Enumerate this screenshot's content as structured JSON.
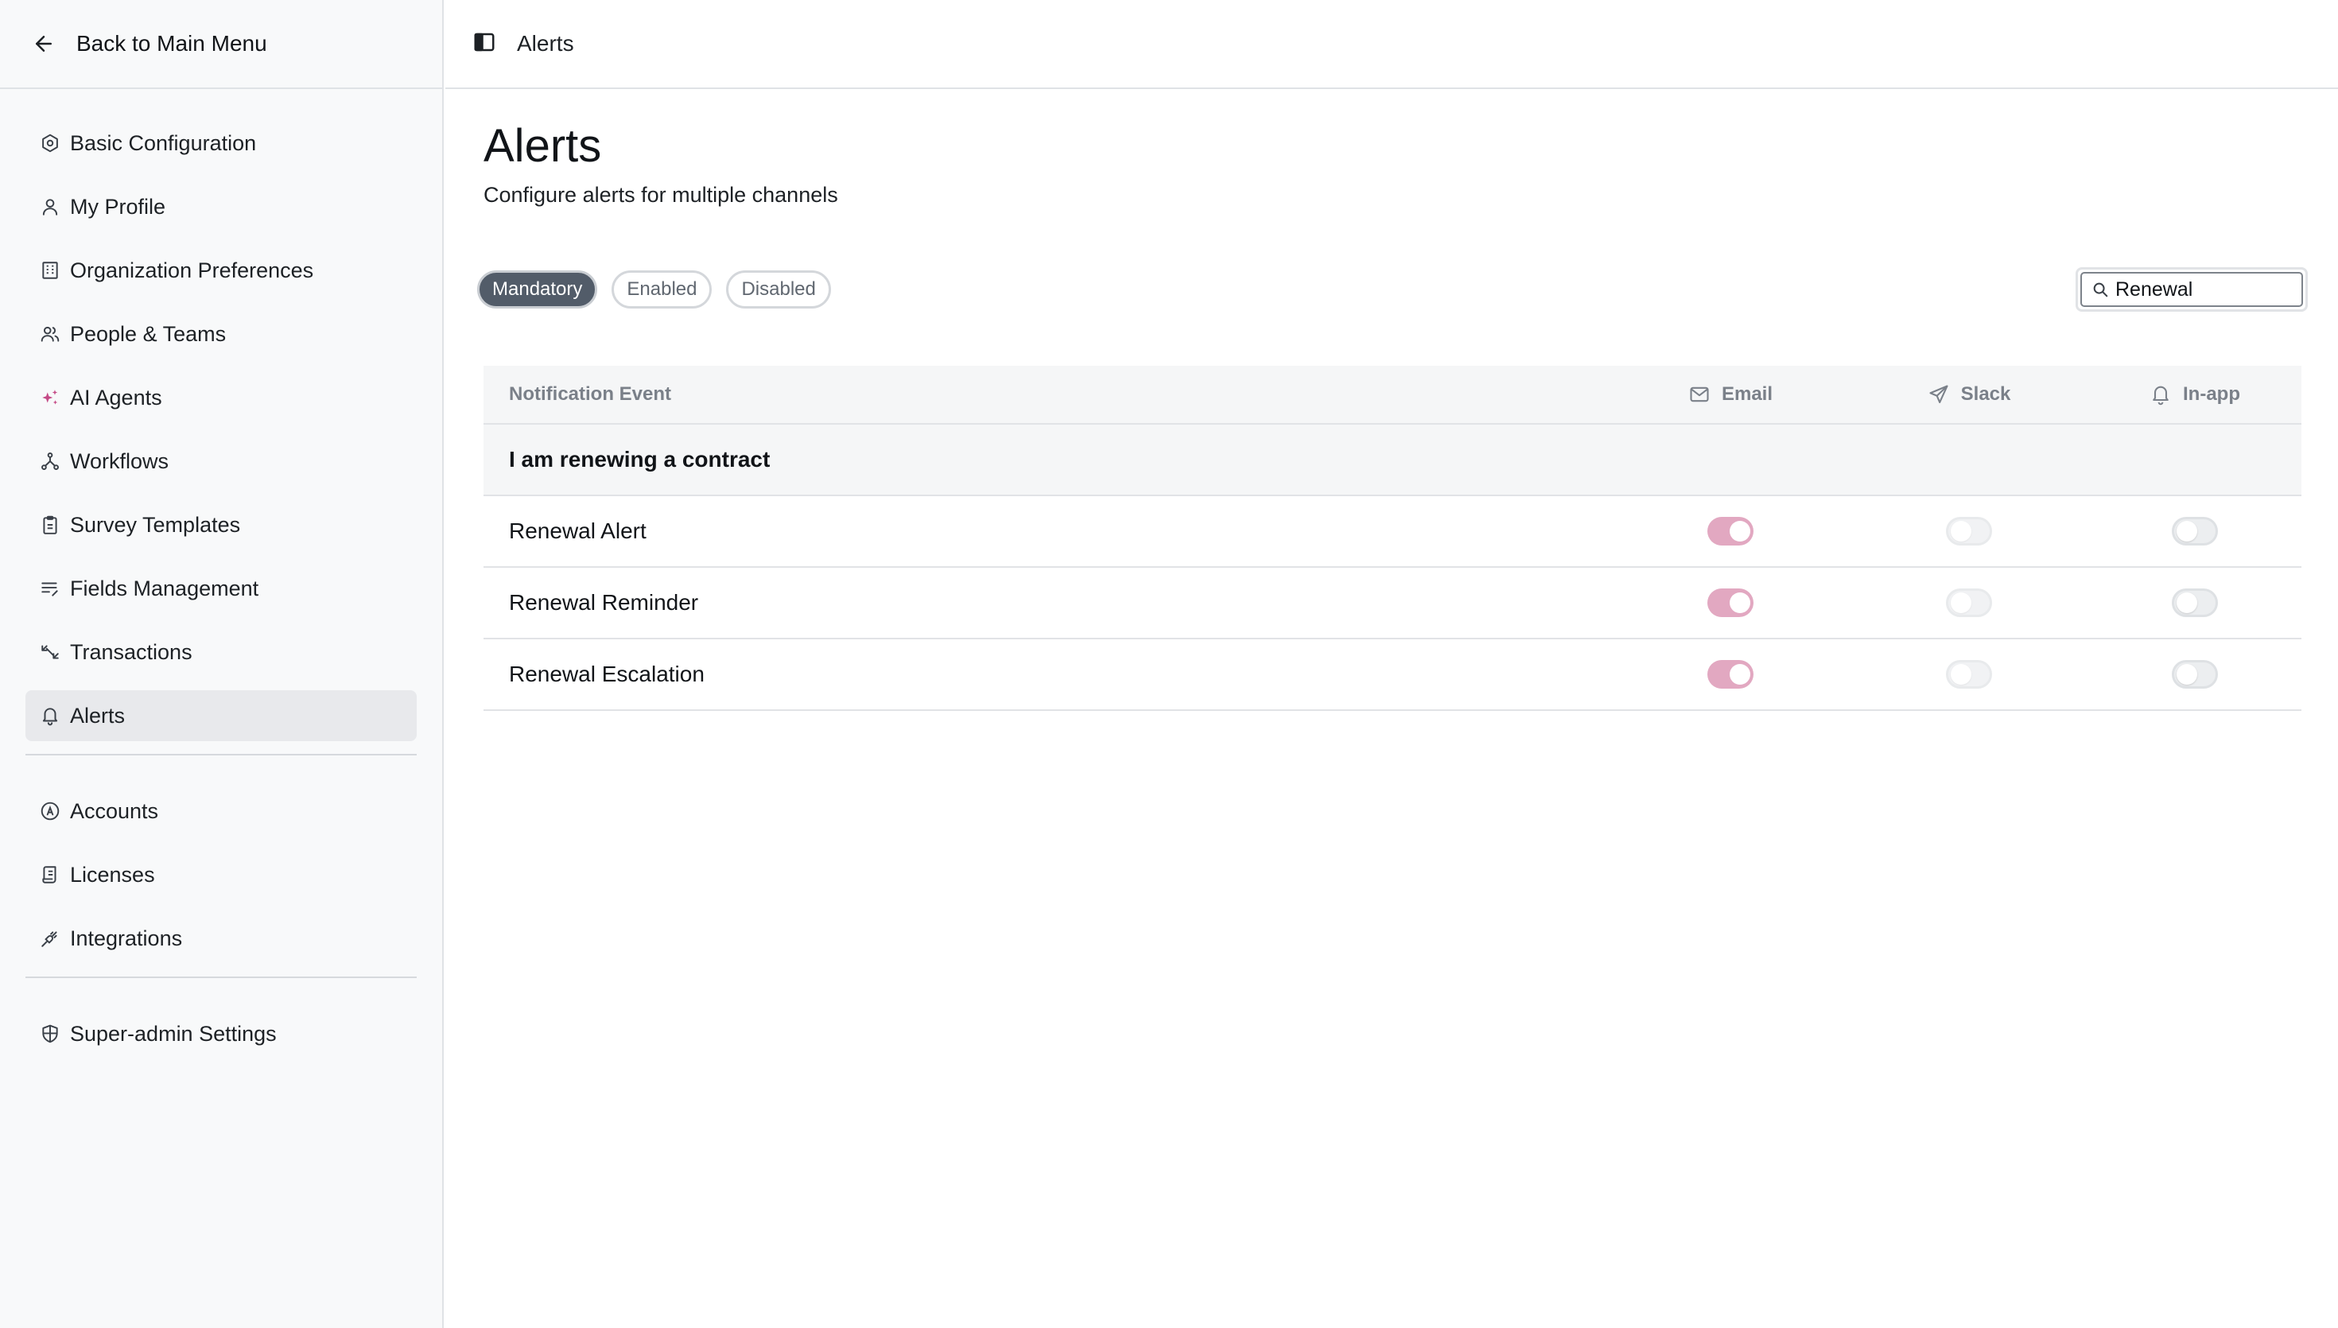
{
  "sidebar": {
    "back_label": "Back to Main Menu",
    "groups": [
      {
        "items": [
          {
            "label": "Basic Configuration",
            "icon": "hexagon-settings-icon"
          },
          {
            "label": "My Profile",
            "icon": "user-icon"
          },
          {
            "label": "Organization Preferences",
            "icon": "building-icon"
          },
          {
            "label": "People & Teams",
            "icon": "users-icon"
          },
          {
            "label": "AI Agents",
            "icon": "sparkles-icon"
          },
          {
            "label": "Workflows",
            "icon": "workflow-icon"
          },
          {
            "label": "Survey Templates",
            "icon": "clipboard-icon"
          },
          {
            "label": "Fields Management",
            "icon": "list-edit-icon"
          },
          {
            "label": "Transactions",
            "icon": "arrows-icon"
          },
          {
            "label": "Alerts",
            "icon": "bell-icon",
            "active": true
          }
        ]
      },
      {
        "items": [
          {
            "label": "Accounts",
            "icon": "circle-a-icon"
          },
          {
            "label": "Licenses",
            "icon": "document-icon"
          },
          {
            "label": "Integrations",
            "icon": "plug-icon"
          }
        ]
      },
      {
        "items": [
          {
            "label": "Super-admin Settings",
            "icon": "shield-icon"
          }
        ]
      }
    ]
  },
  "topbar": {
    "breadcrumb": "Alerts"
  },
  "main": {
    "title": "Alerts",
    "subtitle": "Configure alerts for multiple channels",
    "filters": [
      {
        "label": "Mandatory",
        "active": true
      },
      {
        "label": "Enabled",
        "active": false
      },
      {
        "label": "Disabled",
        "active": false
      }
    ],
    "search": {
      "value": "Renewal"
    },
    "table": {
      "headers": {
        "event": "Notification Event",
        "email": "Email",
        "slack": "Slack",
        "inapp": "In-app"
      },
      "group": "I am renewing a contract",
      "rows": [
        {
          "name": "Renewal Alert",
          "email": true,
          "slack": false,
          "inapp": false
        },
        {
          "name": "Renewal Reminder",
          "email": true,
          "slack": false,
          "inapp": false
        },
        {
          "name": "Renewal Escalation",
          "email": true,
          "slack": false,
          "inapp": false
        }
      ]
    }
  },
  "colors": {
    "toggle_on": "#e2a8c1",
    "chip_active": "#525c69",
    "sidebar_bg": "#f8f9fa",
    "active_nav_bg": "#e8e9ec"
  }
}
